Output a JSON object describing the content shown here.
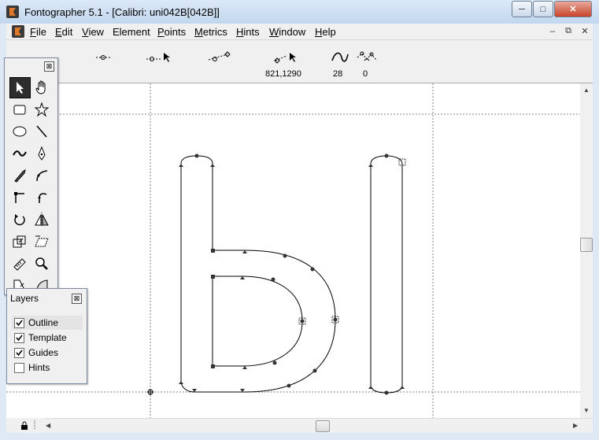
{
  "window": {
    "title": "Fontographer 5.1 - [Calibri: uni042B[042B]]"
  },
  "caption_buttons": {
    "minimize": "─",
    "maximize": "□",
    "close": "✕"
  },
  "mdi_buttons": {
    "minimize": "–",
    "restore": "⧉",
    "close": "✕"
  },
  "menu": {
    "items": [
      {
        "first": "F",
        "rest": "ile"
      },
      {
        "first": "E",
        "rest": "dit"
      },
      {
        "first": "V",
        "rest": "iew"
      },
      {
        "first": "",
        "rest": "Element"
      },
      {
        "first": "P",
        "rest": "oints"
      },
      {
        "first": "M",
        "rest": "etrics"
      },
      {
        "first": "H",
        "rest": "ints"
      },
      {
        "first": "W",
        "rest": "indow"
      },
      {
        "first": "H",
        "rest": "elp"
      }
    ]
  },
  "toolbar": {
    "readouts": {
      "partial_value": "0",
      "position": "821,1290",
      "angle": "28",
      "count": "0"
    },
    "icons": [
      "point-corner-icon",
      "point-tangent-icon",
      "point-move-icon",
      "point-curve-icon",
      "point-position-icon",
      "curve-angle-icon",
      "point-count-icon"
    ]
  },
  "tools_panel": {
    "close": "⊠",
    "tools": [
      "arrow-tool-icon",
      "hand-tool-icon",
      "rectangle-tool-icon",
      "star-tool-icon",
      "ellipse-tool-icon",
      "line-tool-icon",
      "freehand-tool-icon",
      "pen-tool-icon",
      "knife-tool-icon",
      "curve-point-tool-icon",
      "corner-point-tool-icon",
      "tangent-point-tool-icon",
      "rotate-tool-icon",
      "reflect-tool-icon",
      "scale-tool-icon",
      "skew-tool-icon",
      "measure-tool-icon",
      "zoom-tool-icon",
      "perspective-tool-icon",
      "calligraphy-tool-icon"
    ]
  },
  "layers_panel": {
    "title": "Layers",
    "close": "⊠",
    "layers": [
      {
        "label": "Outline",
        "checked": true
      },
      {
        "label": "Template",
        "checked": true
      },
      {
        "label": "Guides",
        "checked": true
      },
      {
        "label": "Hints",
        "checked": false
      }
    ]
  },
  "colors": {
    "selected_tool": "#2d2d2d",
    "guide": "#808080"
  }
}
